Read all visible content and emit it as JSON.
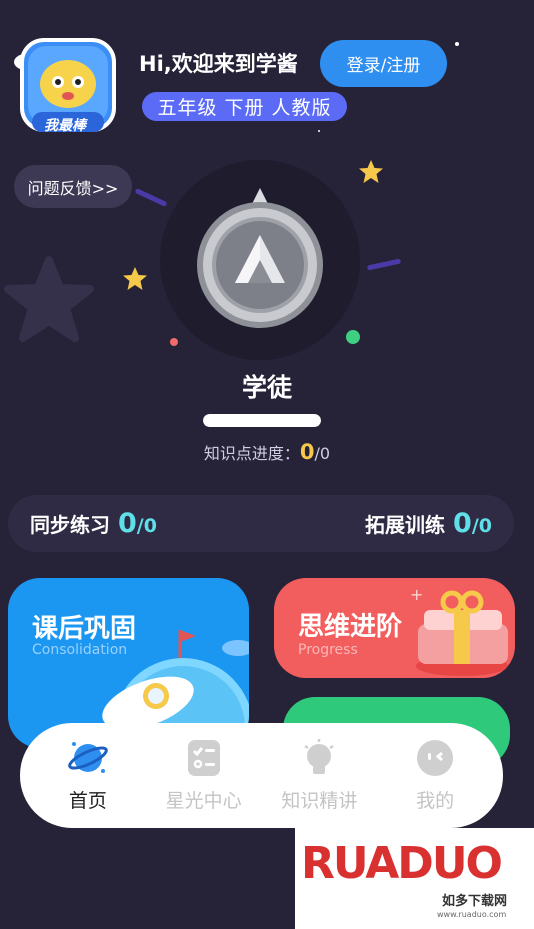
{
  "header": {
    "avatar_badge": "我最棒",
    "greeting": "Hi,欢迎来到学酱",
    "login_label": "登录/注册",
    "grade": "五年级 下册 人教版"
  },
  "feedback_label": "问题反馈>>",
  "rank": {
    "title": "学徒",
    "progress_fraction": 1.0,
    "kp_label": "知识点进度：",
    "kp_done": "0",
    "kp_total": "/0"
  },
  "stats": {
    "sync_label": "同步练习",
    "sync_done": "0",
    "sync_total": "/0",
    "ext_label": "拓展训练",
    "ext_done": "0",
    "ext_total": "/0"
  },
  "cards": {
    "blue_title": "课后巩固",
    "blue_sub": "Consolidation",
    "red_title": "思维进阶",
    "red_sub": "Progress"
  },
  "nav": {
    "home": "首页",
    "star": "星光中心",
    "knowledge": "知识精讲",
    "mine": "我的"
  },
  "watermark": {
    "logo": "RUADUO",
    "sub": "如多下载网",
    "url": "www.ruaduo.com"
  },
  "colors": {
    "background": "#262238",
    "login_button": "#2f8ff0",
    "grade_tag": "#5b6bf5",
    "card_blue": "#1b97f2",
    "card_red": "#f25d5d",
    "card_green": "#2fc97b",
    "stat_accent": "#5fe0e8",
    "progress_accent": "#f7c94b"
  }
}
